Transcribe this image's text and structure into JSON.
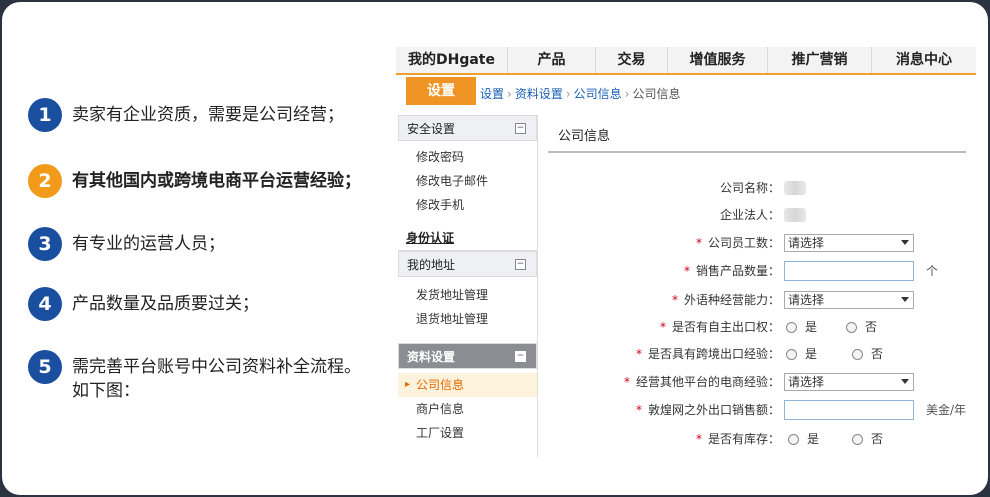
{
  "steps": [
    {
      "num": "1",
      "text": "卖家有企业资质，需要是公司经营；",
      "color": "#1a4fa0",
      "bold": false
    },
    {
      "num": "2",
      "text": "有其他国内或跨境电商平台运营经验；",
      "color": "#f29b1a",
      "bold": true
    },
    {
      "num": "3",
      "text": "有专业的运营人员；",
      "color": "#1a4fa0",
      "bold": false
    },
    {
      "num": "4",
      "text": "产品数量及品质要过关；",
      "color": "#1a4fa0",
      "bold": false
    },
    {
      "num": "5",
      "text_line1": "需完善平台账号中公司资料补全流程。",
      "text_line2": "如下图：",
      "color": "#1a4fa0",
      "bold": false
    }
  ],
  "topnav": [
    "我的DHgate",
    "产品",
    "交易",
    "增值服务",
    "推广营销",
    "消息中心"
  ],
  "settings_tab": "设置",
  "breadcrumb": {
    "b1": "设置",
    "b2": "资料设置",
    "b3": "公司信息",
    "b4": "公司信息",
    "sep": "›"
  },
  "sidebar": {
    "security": {
      "title": "安全设置",
      "toggle": "−",
      "items": [
        "修改密码",
        "修改电子邮件",
        "修改手机"
      ]
    },
    "identity": "身份认证",
    "address": {
      "title": "我的地址",
      "toggle": "−",
      "items": [
        "发货地址管理",
        "退货地址管理"
      ]
    },
    "profile": {
      "title": "资料设置",
      "toggle": "−",
      "items": [
        "公司信息",
        "商户信息",
        "工厂设置"
      ]
    }
  },
  "main_title": "公司信息",
  "form": {
    "company_name": "公司名称：",
    "legal_person": "企业法人：",
    "employees": {
      "label": "公司员工数：",
      "value": "请选择"
    },
    "product_count": {
      "label": "销售产品数量：",
      "unit": "个"
    },
    "language": {
      "label": "外语种经营能力：",
      "value": "请选择"
    },
    "export_right": {
      "label": "是否有自主出口权：",
      "yes": "是",
      "no": "否"
    },
    "cross_border": {
      "label": "是否具有跨境出口经验：",
      "yes": "是",
      "no": "否"
    },
    "other_platform": {
      "label": "经营其他平台的电商经验：",
      "value": "请选择"
    },
    "outside_sales": {
      "label": "敦煌网之外出口销售额：",
      "unit": "美金/年"
    },
    "inventory": {
      "label": "是否有库存：",
      "yes": "是",
      "no": "否"
    },
    "required_mark": "*"
  }
}
